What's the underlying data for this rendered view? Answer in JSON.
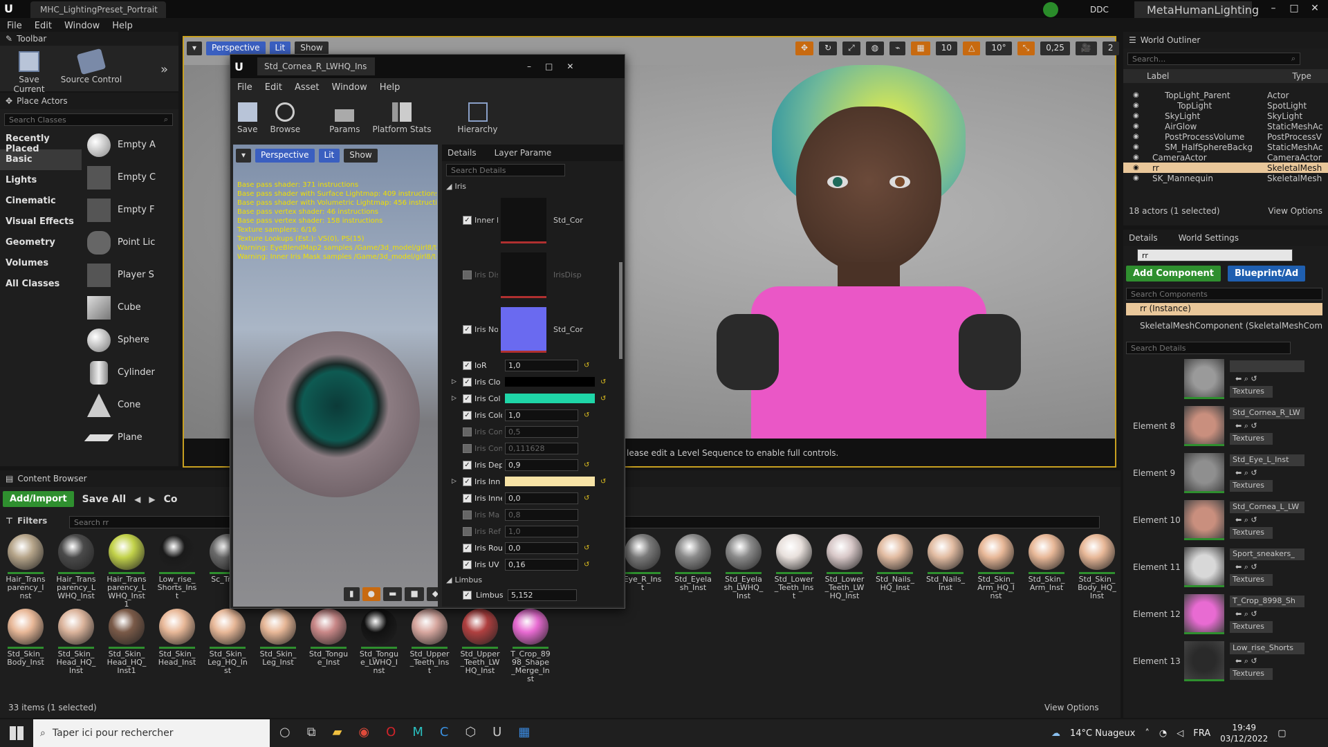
{
  "titlebar": {
    "doc_tab": "MHC_LightingPreset_Portrait",
    "ddc": "DDC",
    "project": "MetaHumanLighting"
  },
  "menu": [
    "File",
    "Edit",
    "Window",
    "Help"
  ],
  "toolbar": {
    "title": "Toolbar",
    "save": "Save Current",
    "source": "Source Control"
  },
  "place_actors": {
    "title": "Place Actors",
    "search_placeholder": "Search Classes",
    "categories": [
      "Recently Placed",
      "Basic",
      "Lights",
      "Cinematic",
      "Visual Effects",
      "Geometry",
      "Volumes",
      "All Classes"
    ],
    "items": [
      "Empty A",
      "Empty C",
      "Empty F",
      "Point Lic",
      "Player S",
      "Cube",
      "Sphere",
      "Cylinder",
      "Cone",
      "Plane"
    ]
  },
  "viewport": {
    "perspective": "Perspective",
    "lit": "Lit",
    "show": "Show",
    "grid": "10",
    "angle": "10°",
    "scale": "0,25",
    "cam": "2",
    "notice": "lease edit a Level Sequence to enable full controls."
  },
  "material_editor": {
    "tab": "Std_Cornea_R_LWHQ_Ins",
    "menu": [
      "File",
      "Edit",
      "Asset",
      "Window",
      "Help"
    ],
    "tools": [
      "Save",
      "Browse",
      "Params",
      "Platform Stats",
      "Hierarchy"
    ],
    "preview_buttons": [
      "Perspective",
      "Lit",
      "Show"
    ],
    "stats": [
      "Base pass shader: 371 instructions",
      "Base pass shader with Surface Lightmap: 409 instructions",
      "Base pass shader with Volumetric Lightmap: 456 instructio",
      "Base pass vertex shader: 46 instructions",
      "Base pass vertex shader: 158 instructions",
      "Texture samplers: 6/16",
      "Texture Lookups (Est.): VS(0), PS(15)",
      "Warning: EyeBlendMap2 samples /Game/3d_model/girl8/te",
      "Warning: Inner Iris Mask samples /Game/3d_model/girl8/te"
    ],
    "details_tab": "Details",
    "layer_tab": "Layer Parame",
    "search_placeholder": "Search Details",
    "iris_section": "Iris",
    "limbus_section": "Limbus",
    "tex_rows": [
      {
        "label": "Inner Ir",
        "tex": "Std_Cor",
        "checked": true
      },
      {
        "label": "Iris Dis",
        "tex": "IrisDisp",
        "checked": false
      },
      {
        "label": "Iris Nor",
        "tex": "Std_Cor",
        "checked": true
      }
    ],
    "rows": [
      {
        "label": "IoR",
        "type": "num",
        "value": "1,0",
        "checked": true
      },
      {
        "label": "Iris Clo",
        "type": "color",
        "color": "#000000",
        "checked": true
      },
      {
        "label": "Iris Col",
        "type": "color",
        "color": "#1fd6a8",
        "checked": true
      },
      {
        "label": "Iris Colo",
        "type": "num",
        "value": "1,0",
        "checked": true
      },
      {
        "label": "Iris Con",
        "type": "num",
        "value": "0,5",
        "checked": false
      },
      {
        "label": "Iris Con",
        "type": "num",
        "value": "0,111628",
        "checked": false
      },
      {
        "label": "Iris Dep",
        "type": "num",
        "value": "0,9",
        "checked": true
      },
      {
        "label": "Iris Inn",
        "type": "color",
        "color": "#f7e3a6",
        "checked": true
      },
      {
        "label": "Iris Inne",
        "type": "num",
        "value": "0,0",
        "checked": true
      },
      {
        "label": "Iris Ma",
        "type": "num",
        "value": "0,8",
        "checked": false
      },
      {
        "label": "Iris Ref",
        "type": "num",
        "value": "1,0",
        "checked": false
      },
      {
        "label": "Iris Rou",
        "type": "num",
        "value": "0,0",
        "checked": true
      },
      {
        "label": "Iris UV",
        "type": "num",
        "value": "0,16",
        "checked": true
      }
    ],
    "limbus_row": {
      "label": "Limbus",
      "value": "5,152"
    }
  },
  "outliner": {
    "title": "World Outliner",
    "search_placeholder": "Search...",
    "col_label": "Label",
    "col_type": "Type",
    "rows": [
      {
        "label": "TopLight_Parent",
        "type": "Actor",
        "indent": 1
      },
      {
        "label": "TopLight",
        "type": "SpotLight",
        "indent": 2
      },
      {
        "label": "SkyLight",
        "type": "SkyLight",
        "indent": 1
      },
      {
        "label": "AirGlow",
        "type": "StaticMeshAc",
        "indent": 1
      },
      {
        "label": "PostProcessVolume",
        "type": "PostProcessV",
        "indent": 1
      },
      {
        "label": "SM_HalfSphereBackg",
        "type": "StaticMeshAc",
        "indent": 1
      },
      {
        "label": "CameraActor",
        "type": "CameraActor",
        "indent": 0
      },
      {
        "label": "rr",
        "type": "SkeletalMesh",
        "indent": 0,
        "selected": true
      },
      {
        "label": "SK_Mannequin",
        "type": "SkeletalMesh",
        "indent": 0
      }
    ],
    "count": "18 actors (1 selected)",
    "view_options": "View Options"
  },
  "details": {
    "tab": "Details",
    "world_tab": "World Settings",
    "name": "rr",
    "add_component": "Add Component",
    "blueprint": "Blueprint/Ad",
    "search_components": "Search Components",
    "instance": "rr (Instance)",
    "component": "SkeletalMeshComponent (SkeletalMeshCompo",
    "search_details": "Search Details",
    "elements": [
      {
        "label": "",
        "mat": "",
        "kind": "Textures",
        "color": "#9a9a9a"
      },
      {
        "label": "Element 8",
        "mat": "Std_Cornea_R_LW",
        "kind": "Textures",
        "color": "#c98f7e"
      },
      {
        "label": "Element 9",
        "mat": "Std_Eye_L_Inst",
        "kind": "Textures",
        "color": "#8f8f8f"
      },
      {
        "label": "Element 10",
        "mat": "Std_Cornea_L_LW",
        "kind": "Textures",
        "color": "#c98f7e"
      },
      {
        "label": "Element 11",
        "mat": "Sport_sneakers_",
        "kind": "Textures",
        "color": "#d8d8d8"
      },
      {
        "label": "Element 12",
        "mat": "T_Crop_8998_Sh",
        "kind": "Textures",
        "color": "#e86bd2"
      },
      {
        "label": "Element 13",
        "mat": "Low_rise_Shorts",
        "kind": "Textures",
        "color": "#2a2a2a"
      }
    ]
  },
  "content_browser": {
    "title": "Content Browser",
    "add": "Add/Import",
    "save_all": "Save All",
    "path": "Co",
    "filters": "Filters",
    "search": "Search rr",
    "count": "33 items (1 selected)",
    "view_options": "View Options",
    "row1": [
      {
        "name": "Hair_Transparency_Inst",
        "c": "#b6a58a"
      },
      {
        "name": "Hair_Transparency_LWHQ_Inst",
        "c": "#4a4a4a"
      },
      {
        "name": "Hair_Transparency_LWHQ_Inst1",
        "c": "#c2d24a"
      },
      {
        "name": "Low_rise_Shorts_Inst",
        "c": "#1a1a1a"
      },
      {
        "name": "Sc_Trans",
        "c": "#6a6a6a"
      }
    ],
    "row1b": [
      {
        "name": "Eye_R_Inst",
        "c": "#7a7a7a"
      },
      {
        "name": "Std_Eyelash_Inst",
        "c": "#8a8a8a"
      },
      {
        "name": "Std_Eyelash_LWHQ_Inst",
        "c": "#8a8a8a"
      },
      {
        "name": "Std_Lower_Teeth_Inst",
        "c": "#e8e0dc"
      },
      {
        "name": "Std_Lower_Teeth_LWHQ_Inst",
        "c": "#d8c8c8"
      },
      {
        "name": "Std_Nails_HQ_Inst",
        "c": "#e2bca2"
      },
      {
        "name": "Std_Nails_Inst",
        "c": "#e2bca2"
      },
      {
        "name": "Std_Skin_Arm_HQ_Inst",
        "c": "#e8b898"
      },
      {
        "name": "Std_Skin_Arm_Inst",
        "c": "#e8b898"
      },
      {
        "name": "Std_Skin_Body_HQ_Inst",
        "c": "#e8b898"
      }
    ],
    "row2": [
      {
        "name": "Std_Skin_Body_Inst",
        "c": "#e8b898"
      },
      {
        "name": "Std_Skin_Head_HQ_Inst",
        "c": "#dbb49c"
      },
      {
        "name": "Std_Skin_Head_HQ_Inst1",
        "c": "#7a5a48"
      },
      {
        "name": "Std_Skin_Head_Inst",
        "c": "#e8b898"
      },
      {
        "name": "Std_Skin_Leg_HQ_Inst",
        "c": "#e8b898"
      },
      {
        "name": "Std_Skin_Leg_Inst",
        "c": "#e8b898"
      },
      {
        "name": "Std_Tongue_Inst",
        "c": "#c98888"
      },
      {
        "name": "Std_Tongue_LWHQ_Inst",
        "c": "#111111"
      },
      {
        "name": "Std_Upper_Teeth_Inst",
        "c": "#d8a8a0"
      },
      {
        "name": "Std_Upper_Teeth_LWHQ_Inst",
        "c": "#b04040"
      },
      {
        "name": "T_Crop_8998_Shape_Merge_Inst",
        "c": "#e86bd2"
      }
    ]
  },
  "taskbar": {
    "search": "Taper ici pour rechercher",
    "weather": "14°C Nuageux",
    "lang": "FRA",
    "time": "19:49",
    "date": "03/12/2022"
  }
}
